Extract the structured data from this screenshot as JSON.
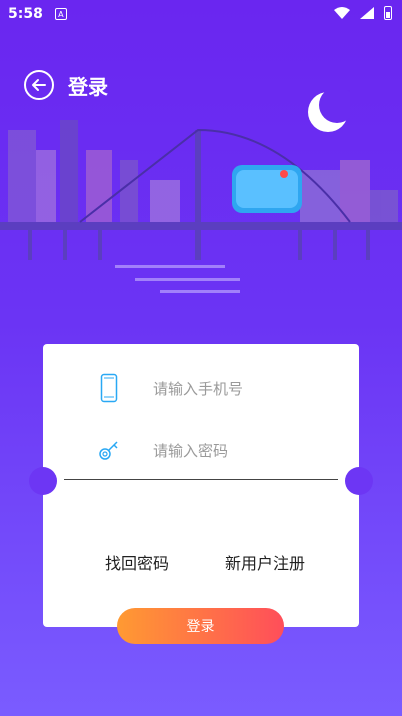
{
  "status_bar": {
    "time": "5:58",
    "notification_badge": "A"
  },
  "header": {
    "title": "登录"
  },
  "form": {
    "phone_placeholder": "请输入手机号",
    "password_placeholder": "请输入密码",
    "forgot_link": "找回密码",
    "register_link": "新用户注册",
    "login_button": "登录"
  },
  "colors": {
    "bg_top": "#6a26f0",
    "bg_bottom": "#7a5cff",
    "button_start": "#ff9a32",
    "button_end": "#ff4e5a",
    "icon": "#29a8f4"
  }
}
